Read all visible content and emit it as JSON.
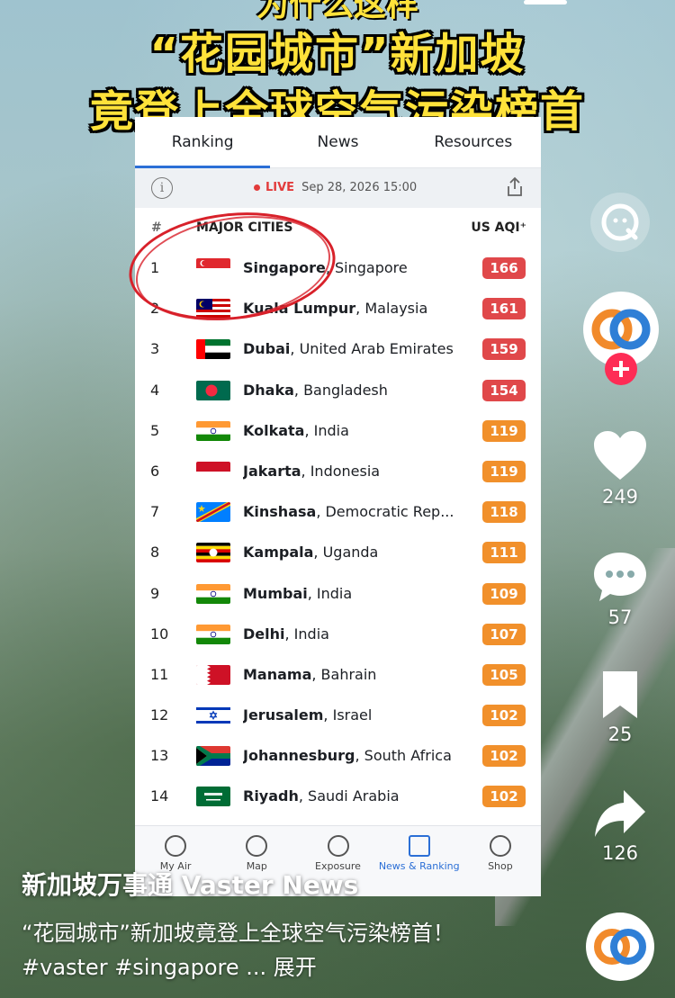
{
  "video": {
    "headline_line1": "“花园城市”新加坡",
    "headline_line2": "竟登上全球空气污染榜首",
    "headline_top_partial": "为什么这样"
  },
  "app": {
    "tabs": [
      "Ranking",
      "News",
      "Resources"
    ],
    "live_label": "LIVE",
    "live_time": "Sep 28, 2026 15:00",
    "header_num": "#",
    "header_cities": "MAJOR CITIES",
    "header_aqi": "US AQI⁺",
    "rows": [
      {
        "rank": "1",
        "city": "Singapore",
        "country": "Singapore",
        "aqi": "166",
        "color": "#e0484a",
        "flag": "sg"
      },
      {
        "rank": "2",
        "city": "Kuala Lumpur",
        "country": "Malaysia",
        "aqi": "161",
        "color": "#e0484a",
        "flag": "my"
      },
      {
        "rank": "3",
        "city": "Dubai",
        "country": "United Arab Emirates",
        "aqi": "159",
        "color": "#e0484a",
        "flag": "ae"
      },
      {
        "rank": "4",
        "city": "Dhaka",
        "country": "Bangladesh",
        "aqi": "154",
        "color": "#e0484a",
        "flag": "bd"
      },
      {
        "rank": "5",
        "city": "Kolkata",
        "country": "India",
        "aqi": "119",
        "color": "#f1902b",
        "flag": "in"
      },
      {
        "rank": "6",
        "city": "Jakarta",
        "country": "Indonesia",
        "aqi": "119",
        "color": "#f1902b",
        "flag": "id"
      },
      {
        "rank": "7",
        "city": "Kinshasa",
        "country": "Democratic Rep...",
        "aqi": "118",
        "color": "#f1902b",
        "flag": "cd"
      },
      {
        "rank": "8",
        "city": "Kampala",
        "country": "Uganda",
        "aqi": "111",
        "color": "#f1902b",
        "flag": "ug"
      },
      {
        "rank": "9",
        "city": "Mumbai",
        "country": "India",
        "aqi": "109",
        "color": "#f1902b",
        "flag": "in"
      },
      {
        "rank": "10",
        "city": "Delhi",
        "country": "India",
        "aqi": "107",
        "color": "#f1902b",
        "flag": "in"
      },
      {
        "rank": "11",
        "city": "Manama",
        "country": "Bahrain",
        "aqi": "105",
        "color": "#f1902b",
        "flag": "bh"
      },
      {
        "rank": "12",
        "city": "Jerusalem",
        "country": "Israel",
        "aqi": "102",
        "color": "#f1902b",
        "flag": "il"
      },
      {
        "rank": "13",
        "city": "Johannesburg",
        "country": "South Africa",
        "aqi": "102",
        "color": "#f1902b",
        "flag": "za"
      },
      {
        "rank": "14",
        "city": "Riyadh",
        "country": "Saudi Arabia",
        "aqi": "102",
        "color": "#f1902b",
        "flag": "sa"
      }
    ],
    "nav": [
      {
        "label": "My Air",
        "icon": "heart-location-icon"
      },
      {
        "label": "Map",
        "icon": "globe-icon"
      },
      {
        "label": "Exposure",
        "icon": "exposure-icon"
      },
      {
        "label": "News & Ranking",
        "icon": "news-icon"
      },
      {
        "label": "Shop",
        "icon": "cart-icon"
      }
    ]
  },
  "sidebar": {
    "likes": "249",
    "comments": "57",
    "bookmarks": "25",
    "shares": "126"
  },
  "post": {
    "author": "新加坡万事通 Vaster News",
    "description": "“花园城市”新加坡竟登上全球空气污染榜首！#vaster #singapore ... 展开"
  },
  "colors": {
    "headline": "#ffe23a",
    "accent_blue": "#2b6fd6",
    "aqi_red": "#e0484a",
    "aqi_orange": "#f1902b",
    "like_plus": "#fe2c55"
  }
}
